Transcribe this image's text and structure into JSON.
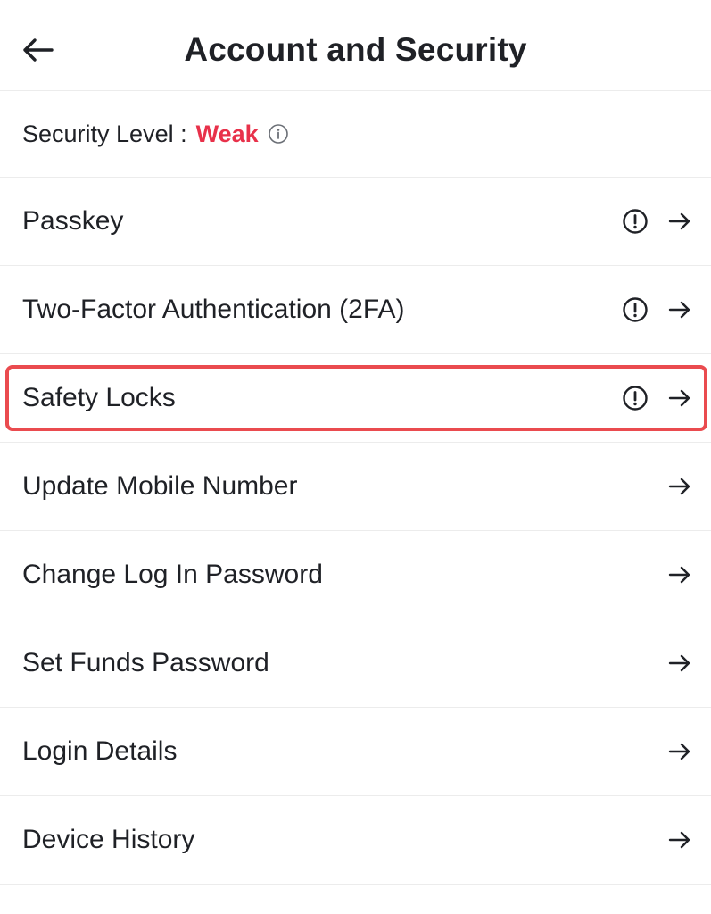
{
  "header": {
    "title": "Account and Security"
  },
  "security": {
    "label": "Security Level :",
    "value": "Weak",
    "value_color": "#e8314a"
  },
  "menu": {
    "items": [
      {
        "label": "Passkey",
        "warning": true
      },
      {
        "label": "Two-Factor Authentication (2FA)",
        "warning": true
      },
      {
        "label": "Safety Locks",
        "warning": true,
        "highlighted": true
      },
      {
        "label": "Update Mobile Number",
        "warning": false
      },
      {
        "label": "Change Log In Password",
        "warning": false
      },
      {
        "label": "Set Funds Password",
        "warning": false
      },
      {
        "label": "Login Details",
        "warning": false
      },
      {
        "label": "Device History",
        "warning": false
      }
    ]
  },
  "icons": {
    "back": "arrow-left-icon",
    "info": "info-icon",
    "warning": "exclamation-circle-icon",
    "row_arrow": "arrow-right-icon"
  },
  "colors": {
    "highlight_border": "#ea4b4f",
    "text": "#1f2126",
    "divider": "#ececec"
  }
}
